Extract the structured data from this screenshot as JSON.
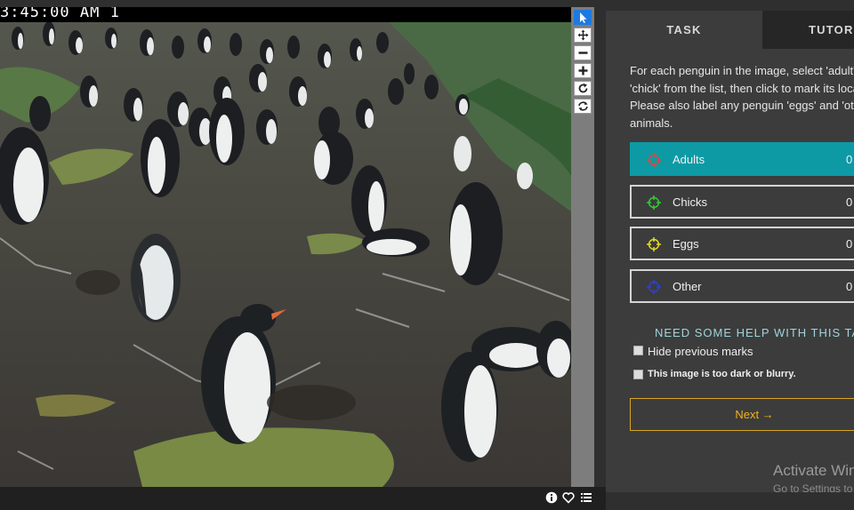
{
  "camera": {
    "timestamp": "3:45:00 AM   1"
  },
  "toolbar": {
    "tools": [
      "pointer-icon",
      "pan-icon",
      "zoom-out-icon",
      "zoom-in-icon",
      "rotate-icon",
      "reset-icon"
    ]
  },
  "footer_icons": [
    "info-icon",
    "heart-icon",
    "list-icon"
  ],
  "task": {
    "tabs": [
      "TASK",
      "TUTORIAL"
    ],
    "instructions": [
      "For each penguin in the image, select 'adult' or",
      "'chick' from the list, then click to mark its location.",
      "Please also label any penguin 'eggs' and 'other'",
      "animals."
    ],
    "choices": [
      {
        "label": "Adults",
        "count": "0",
        "color": "#e0463c",
        "selected": true
      },
      {
        "label": "Chicks",
        "count": "0",
        "color": "#33cc33",
        "selected": false
      },
      {
        "label": "Eggs",
        "count": "0",
        "color": "#e5dc20",
        "selected": false
      },
      {
        "label": "Other",
        "count": "0",
        "color": "#2f3fd6",
        "selected": false
      }
    ],
    "help_text": "NEED SOME HELP WITH THIS TASK?",
    "checkbox_hide": "Hide previous marks",
    "checkbox_dark": "This image is too dark or blurry.",
    "next_label": "Next →"
  },
  "watermark": {
    "line1": "Activate Windows",
    "line2": "Go to Settings to activate Windows."
  },
  "colors": {
    "accent": "#0d9aa5",
    "next": "#f2b320",
    "panel": "#3c3c3c"
  }
}
